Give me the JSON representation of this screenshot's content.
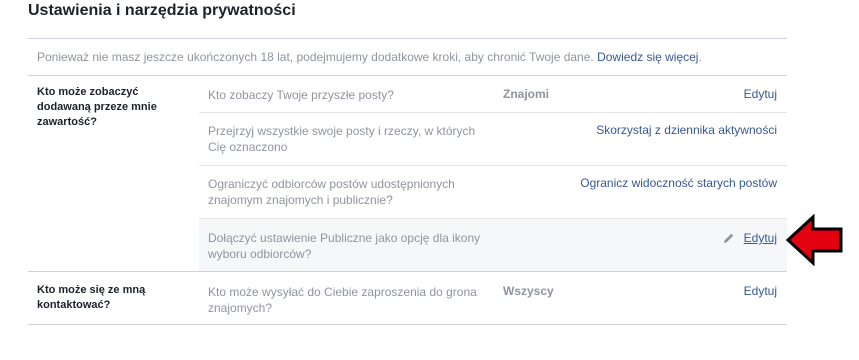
{
  "page": {
    "title": "Ustawienia i narzędzia prywatności"
  },
  "notice": {
    "text": "Ponieważ nie masz jeszcze ukończonych 18 lat, podejmujemy dodatkowe kroki, aby chronić Twoje dane.",
    "link": "Dowiedz się więcej",
    "suffix": "."
  },
  "sections": [
    {
      "label": "Kto może zobaczyć dodawaną przeze mnie zawartość?",
      "rows": [
        {
          "question": "Kto zobaczy Twoje przyszłe posty?",
          "value": "Znajomi",
          "action": "Edytuj"
        },
        {
          "question": "Przejrzyj wszystkie swoje posty i rzeczy, w których Cię oznaczono",
          "value": "",
          "action": "Skorzystaj z dziennika aktywności"
        },
        {
          "question": "Ograniczyć odbiorców postów udostępnionych znajomym znajomych i publicznie?",
          "value": "",
          "action": "Ogranicz widoczność starych postów"
        },
        {
          "question": "Dołączyć ustawienie Publiczne jako opcję dla ikony wyboru odbiorców?",
          "value": "",
          "action": "Edytuj"
        }
      ]
    },
    {
      "label": "Kto może się ze mną kontaktować?",
      "rows": [
        {
          "question": "Kto może wysyłać do Ciebie zaproszenia do grona znajomych?",
          "value": "Wszyscy",
          "action": "Edytuj"
        }
      ]
    }
  ],
  "icons": {
    "pencil": "pencil-icon",
    "arrow": "red-arrow-left-icon"
  },
  "colors": {
    "link": "#365899",
    "muted": "#90949c",
    "highlight_row": "#f6f7f9",
    "arrow": "#e3010f"
  }
}
